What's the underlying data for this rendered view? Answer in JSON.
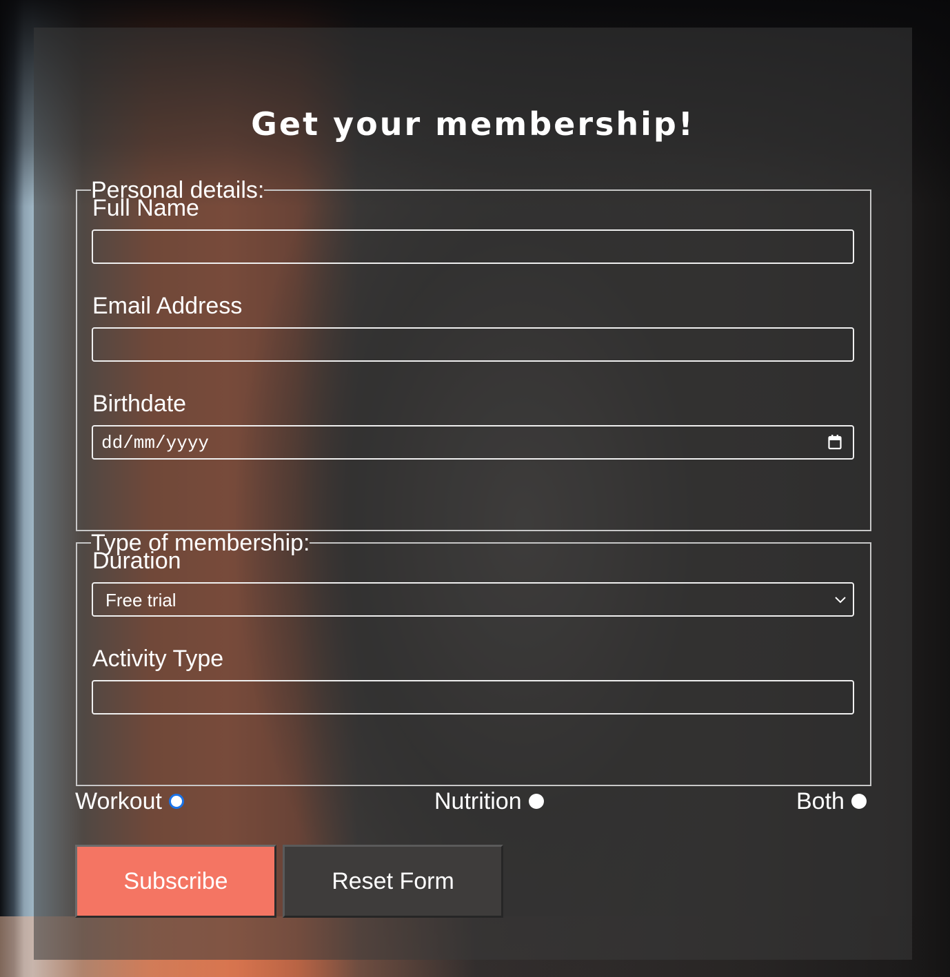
{
  "form": {
    "title": "Get your membership!",
    "personal": {
      "legend": "Personal details:",
      "full_name_label": "Full Name",
      "full_name_value": "",
      "email_label": "Email Address",
      "email_value": "",
      "birthdate_label": "Birthdate",
      "birthdate_placeholder": "dd/mm/yyyy"
    },
    "membership": {
      "legend": "Type of membership:",
      "duration_label": "Duration",
      "duration_selected": "Free trial",
      "activity_label": "Activity Type",
      "activity_value": ""
    },
    "options": [
      {
        "label": "Workout",
        "selected": true
      },
      {
        "label": "Nutrition",
        "selected": false
      },
      {
        "label": "Both",
        "selected": false
      }
    ],
    "buttons": {
      "subscribe": "Subscribe",
      "reset": "Reset Form"
    }
  },
  "colors": {
    "subscribe_bg": "#f47563",
    "reset_bg": "#3e3c3b",
    "radio_selected": "#1a73e8"
  },
  "icons": {
    "calendar": "calendar-icon",
    "dropdown": "chevron-down-icon"
  }
}
